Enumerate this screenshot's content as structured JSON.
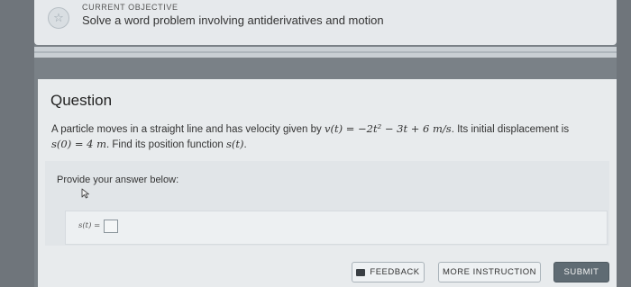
{
  "objective": {
    "kicker": "CURRENT OBJECTIVE",
    "title": "Solve a word problem involving antiderivatives and motion"
  },
  "question": {
    "heading": "Question",
    "line1_intro": "A particle moves in a straight line and has velocity given by ",
    "velocity_fn": "v(t)",
    "velocity_expr": " = −2t² − 3t + 6 m/s",
    "line1_tail": ". Its initial displacement is",
    "initial": "s(0) = 4 m",
    "line2_tail": ". Find its position function ",
    "position_fn": "s(t)",
    "period": "."
  },
  "answer": {
    "prompt": "Provide your answer below:",
    "label": "s(t) ="
  },
  "buttons": {
    "feedback": "FEEDBACK",
    "more_instruction": "MORE INSTRUCTION",
    "submit": "SUBMIT"
  },
  "icons": {
    "objective": "star-icon",
    "feedback": "message-icon",
    "cursor": "cursor-icon"
  }
}
